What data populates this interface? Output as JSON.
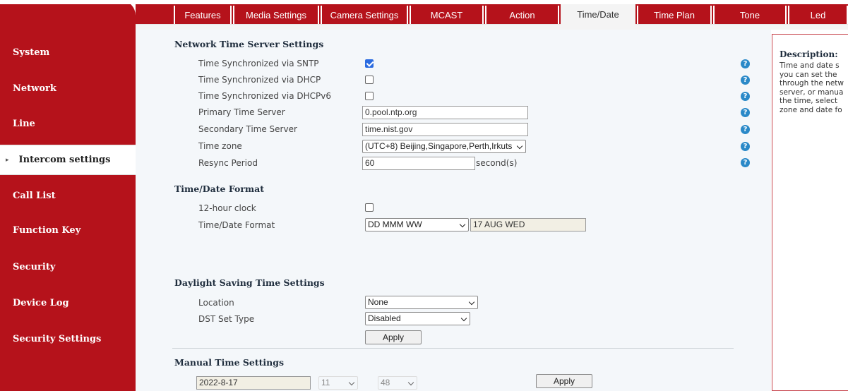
{
  "tabs": [
    {
      "label": "Features"
    },
    {
      "label": "Media Settings"
    },
    {
      "label": "Camera Settings"
    },
    {
      "label": "MCAST"
    },
    {
      "label": "Action"
    },
    {
      "label": "Time/Date",
      "active": true
    },
    {
      "label": "Time Plan"
    },
    {
      "label": "Tone"
    },
    {
      "label": "Led"
    }
  ],
  "sidebar": {
    "items": [
      {
        "label": "System"
      },
      {
        "label": "Network"
      },
      {
        "label": "Line"
      },
      {
        "label": "Intercom settings",
        "active": true
      },
      {
        "label": "Call List"
      },
      {
        "label": "Function Key"
      },
      {
        "label": "Security"
      },
      {
        "label": "Device Log"
      },
      {
        "label": "Security Settings"
      }
    ]
  },
  "network_time": {
    "title": "Network Time Server Settings",
    "sntp": {
      "label": "Time Synchronized via SNTP",
      "checked": true
    },
    "dhcp": {
      "label": "Time Synchronized via DHCP",
      "checked": false
    },
    "dhcpv6": {
      "label": "Time Synchronized via DHCPv6",
      "checked": false
    },
    "primary": {
      "label": "Primary Time Server",
      "value": "0.pool.ntp.org"
    },
    "secondary": {
      "label": "Secondary Time Server",
      "value": "time.nist.gov"
    },
    "timezone": {
      "label": "Time zone",
      "value": "(UTC+8) Beijing,Singapore,Perth,Irkuts"
    },
    "resync": {
      "label": "Resync Period",
      "value": "60",
      "unit": "second(s)"
    }
  },
  "format": {
    "title": "Time/Date Format",
    "hour12": {
      "label": "12-hour clock",
      "checked": false
    },
    "format": {
      "label": "Time/Date Format",
      "value": "DD MMM WW",
      "preview": "17 AUG WED"
    }
  },
  "dst": {
    "title": "Daylight Saving Time Settings",
    "location": {
      "label": "Location",
      "value": "None"
    },
    "type": {
      "label": "DST Set Type",
      "value": "Disabled"
    },
    "apply": "Apply"
  },
  "manual": {
    "title": "Manual Time Settings",
    "date": "2022-8-17",
    "hour": "11",
    "minute": "48",
    "apply": "Apply"
  },
  "help_glyph": "?",
  "description": {
    "title": "Description:",
    "lines": [
      "Time and date s",
      "you can set the",
      "through the netw",
      "server, or manua",
      "the time, select",
      "zone and date fo"
    ]
  },
  "colors": {
    "brand_red": "#b5121b",
    "checkbox_blue": "#2b6be0",
    "help_blue": "#2a89c8"
  }
}
